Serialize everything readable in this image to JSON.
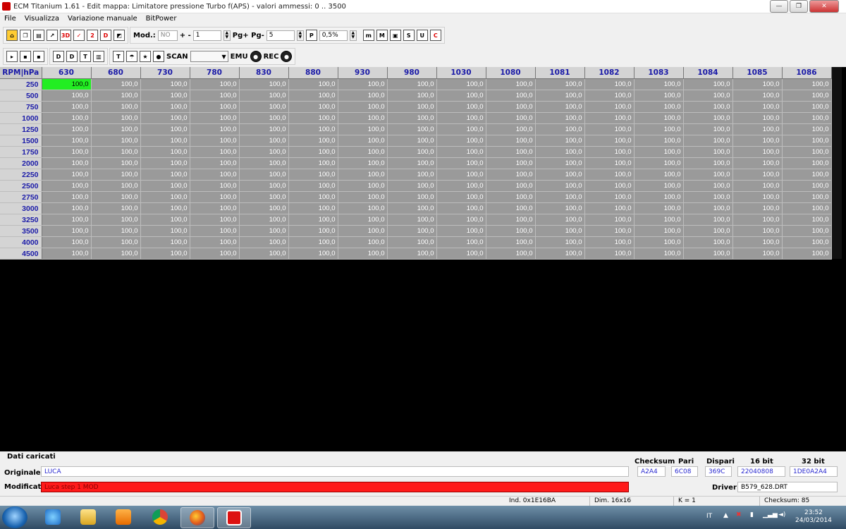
{
  "window": {
    "title": "ECM Titanium 1.61 - Edit mappa: Limitatore pressione Turbo f(APS) - valori ammessi: 0 .. 3500",
    "minimize": "—",
    "maximize": "❐",
    "close": "✕"
  },
  "menu": [
    "File",
    "Visualizza",
    "Variazione manuale",
    "BitPower"
  ],
  "toolbar1": {
    "icons_left": [
      "home-icon",
      "copy-icon",
      "window-icon",
      "chart-icon",
      "3d-icon",
      "check-icon",
      "compare-icon",
      "d-icon",
      "color-icon"
    ],
    "icon_glyphs": [
      "⌂",
      "❐",
      "▤",
      "↗",
      "3D",
      "✓",
      "2",
      "D",
      "◩"
    ],
    "mod_label": "Mod.:",
    "mod_value": "NO",
    "step_label": "+ -",
    "step_value": "1",
    "pg_label": "Pg+ Pg-",
    "pg_value": "5",
    "pct_icon": "P",
    "pct_value": "0,5%",
    "right_glyphs": [
      "m",
      "M",
      "▣",
      "S",
      "U",
      "C"
    ]
  },
  "toolbar2": {
    "file_glyphs": [
      "▸",
      "▪",
      "▪"
    ],
    "view_glyphs": [
      "D",
      "D",
      "T",
      "▥"
    ],
    "tool_glyphs": [
      "T",
      "☂",
      "★",
      "●"
    ],
    "scan_label": "SCAN",
    "emu_label": "EMU",
    "rec_label": "REC"
  },
  "grid": {
    "corner": "RPM|hPa",
    "columns": [
      "630",
      "680",
      "730",
      "780",
      "830",
      "880",
      "930",
      "980",
      "1030",
      "1080",
      "1081",
      "1082",
      "1083",
      "1084",
      "1085",
      "1086"
    ],
    "rows": [
      "250",
      "500",
      "750",
      "1000",
      "1250",
      "1500",
      "1750",
      "2000",
      "2250",
      "2500",
      "2750",
      "3000",
      "3250",
      "3500",
      "4000",
      "4500"
    ],
    "cell_value": "100,0",
    "selected_row": 0,
    "selected_col": 0,
    "selected_color": "#22ee22"
  },
  "bottom": {
    "dati_caricati": "Dati caricati",
    "originale_label": "Originale",
    "originale_value": "LUCA",
    "modificato_label": "Modificato",
    "modificato_value": "Luca step 1 MOD",
    "checksum_label": "Checksum",
    "pari_label": "Pari",
    "dispari_label": "Dispari",
    "bit16_label": "16 bit",
    "bit32_label": "32 bit",
    "checksum_value": "A2A4",
    "pari_value": "6C08",
    "dispari_value": "369C",
    "bit16_value": "22040808",
    "bit32_value": "1DE0A2A4",
    "driver_label": "Driver",
    "driver_value": "B579_628.DRT"
  },
  "status": {
    "ind": "Ind. 0x1E16BA",
    "dim": "Dim. 16x16",
    "k": "K = 1",
    "checksum": "Checksum: 85"
  },
  "taskbar": {
    "apps": [
      "ie-icon",
      "folder-icon",
      "media-player-icon",
      "chrome-icon",
      "firefox-icon",
      "ecm-titanium-icon"
    ],
    "lang": "IT",
    "time": "23:52",
    "date": "24/03/2014"
  }
}
